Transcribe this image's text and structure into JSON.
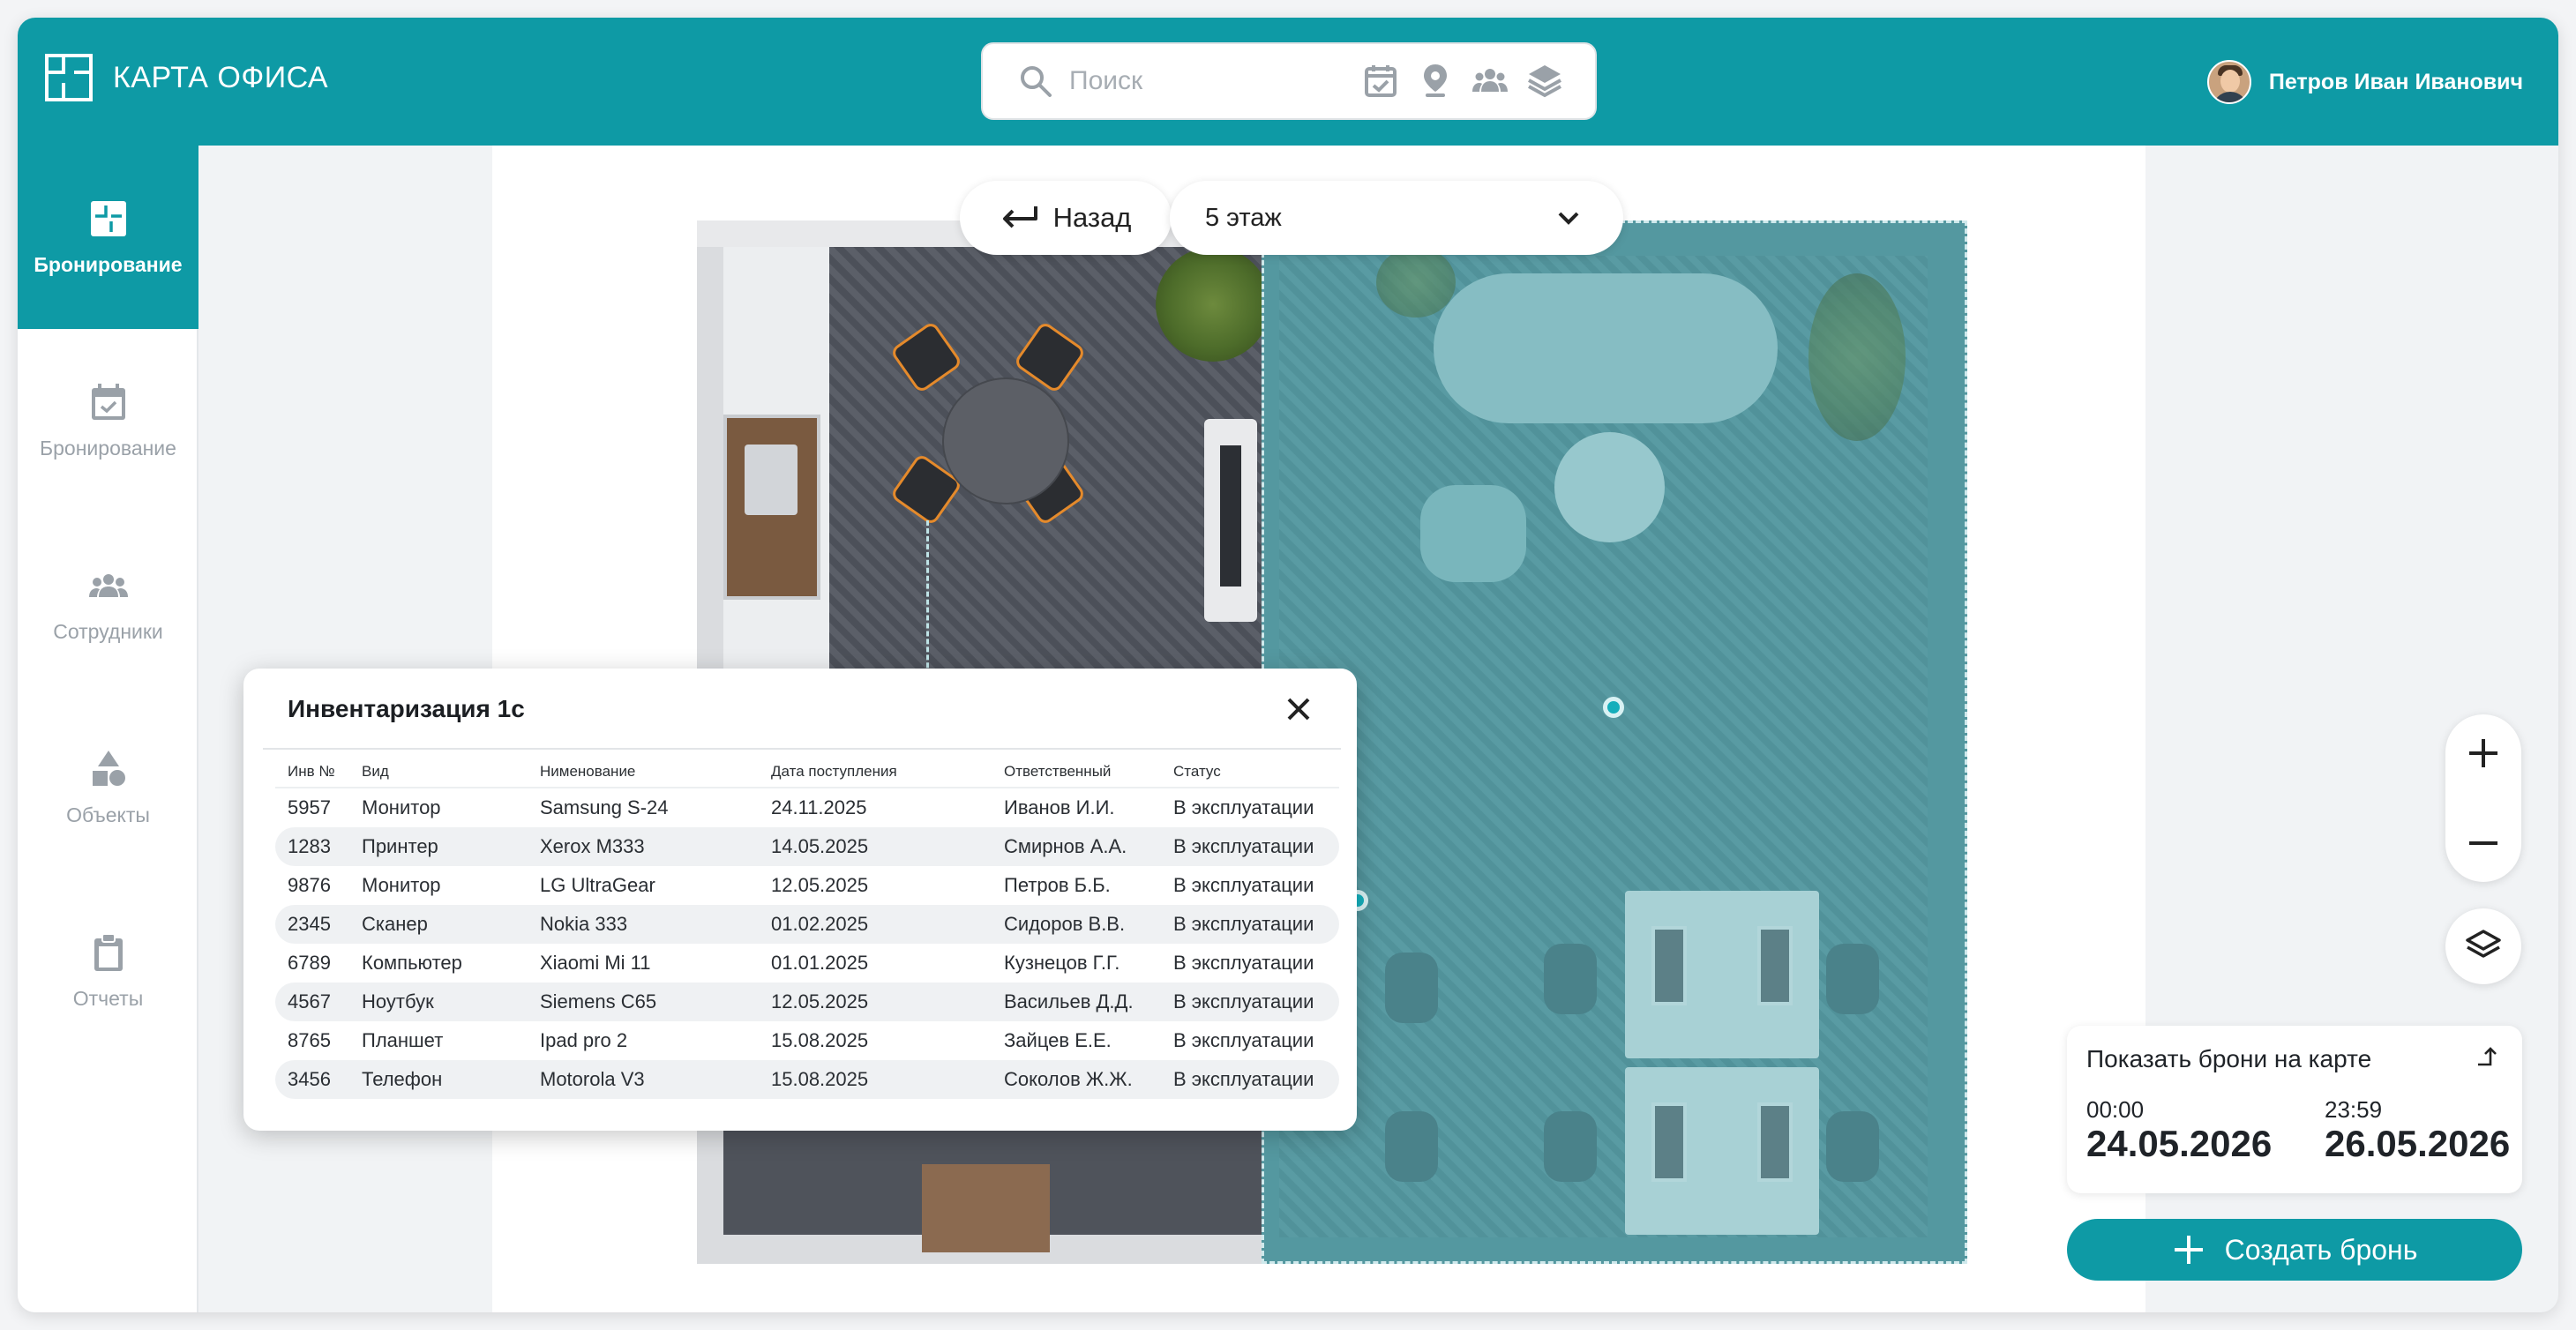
{
  "app": {
    "title": "КАРТА ОФИСА"
  },
  "search": {
    "placeholder": "Поиск"
  },
  "header": {
    "filter_icons": [
      "calendar-check-icon",
      "location-pin-icon",
      "people-icon",
      "layers-icon"
    ]
  },
  "user": {
    "name": "Петров Иван Иванович"
  },
  "sidebar": {
    "items": [
      {
        "label": "Бронирование",
        "icon": "floorplan-icon",
        "active": true
      },
      {
        "label": "Бронирование",
        "icon": "calendar-check-icon",
        "active": false
      },
      {
        "label": "Сотрудники",
        "icon": "people-icon",
        "active": false
      },
      {
        "label": "Объекты",
        "icon": "shapes-icon",
        "active": false
      },
      {
        "label": "Отчеты",
        "icon": "clipboard-icon",
        "active": false
      }
    ]
  },
  "map": {
    "back_label": "Назад",
    "floor": "5 этаж"
  },
  "inventory": {
    "title": "Инвентаризация 1с",
    "columns": [
      "Инв №",
      "Вид",
      "Нименование",
      "Дата поступления",
      "Ответственный",
      "Статус"
    ],
    "rows": [
      [
        "5957",
        "Монитор",
        "Samsung S-24",
        "24.11.2025",
        "Иванов И.И.",
        "В эксплуатации"
      ],
      [
        "1283",
        "Принтер",
        "Xerox M333",
        "14.05.2025",
        "Смирнов А.А.",
        "В эксплуатации"
      ],
      [
        "9876",
        "Монитор",
        "LG UltraGear",
        "12.05.2025",
        "Петров Б.Б.",
        "В эксплуатации"
      ],
      [
        "2345",
        "Сканер",
        "Nokia 333",
        "01.02.2025",
        "Сидоров В.В.",
        "В эксплуатации"
      ],
      [
        "6789",
        "Компьютер",
        "Xiaomi Mi 11",
        "01.01.2025",
        "Кузнецов Г.Г.",
        "В эксплуатации"
      ],
      [
        "4567",
        "Ноутбук",
        "Siemens C65",
        "12.05.2025",
        "Васильев Д.Д.",
        "В эксплуатации"
      ],
      [
        "8765",
        "Планшет",
        "Ipad pro 2",
        "15.08.2025",
        "Зайцев Е.Е.",
        "В эксплуатации"
      ],
      [
        "3456",
        "Телефон",
        "Motorola V3",
        "15.08.2025",
        "Соколов Ж.Ж.",
        "В эксплуатации"
      ]
    ]
  },
  "bookings": {
    "show_label": "Показать брони на карте",
    "start_time": "00:00",
    "start_date": "24.05.2026",
    "end_time": "23:59",
    "end_date": "26.05.2026"
  },
  "actions": {
    "create_label": "Создать бронь"
  },
  "colors": {
    "accent": "#0e9aa5",
    "muted_icon": "#9aa1a8"
  }
}
